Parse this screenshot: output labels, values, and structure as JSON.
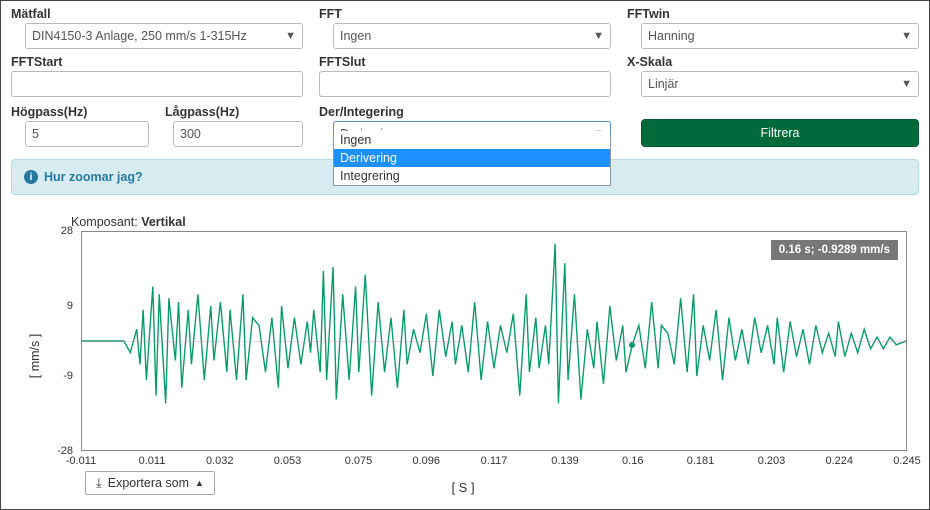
{
  "form": {
    "matfall": {
      "label": "Mätfall",
      "value": "DIN4150-3 Anlage, 250 mm/s 1-315Hz"
    },
    "fft": {
      "label": "FFT",
      "value": "Ingen"
    },
    "fftwin": {
      "label": "FFTwin",
      "value": "Hanning"
    },
    "fftstart": {
      "label": "FFTStart",
      "value": ""
    },
    "fftslut": {
      "label": "FFTSlut",
      "value": ""
    },
    "xskala": {
      "label": "X-Skala",
      "value": "Linjär"
    },
    "hogpass": {
      "label": "Högpass(Hz)",
      "value": "5"
    },
    "lagpass": {
      "label": "Lågpass(Hz)",
      "value": "300"
    },
    "derint": {
      "label": "Der/Integering",
      "value": "Derivering",
      "options": [
        "Ingen",
        "Derivering",
        "Integrering"
      ]
    },
    "filter_btn": "Filtrera"
  },
  "alert": {
    "text": "Hur zoomar jag?"
  },
  "component": {
    "label": "Komposant: ",
    "value": "Vertikal"
  },
  "chart_data": {
    "type": "line",
    "title": "",
    "xlabel": "[ S ]",
    "ylabel": "[  mm/s  ]",
    "xlim": [
      -0.011,
      0.245
    ],
    "ylim": [
      -28,
      28
    ],
    "x_ticks": [
      -0.011,
      0.011,
      0.032,
      0.053,
      0.075,
      0.096,
      0.117,
      0.139,
      0.16,
      0.181,
      0.203,
      0.224,
      0.245
    ],
    "y_ticks": [
      -28,
      -9,
      9,
      28
    ],
    "tooltip": "0.16 s; -0.9289 mm/s",
    "cursor": {
      "x": 0.16,
      "y": -0.9289
    },
    "x": [
      -0.011,
      -0.008,
      -0.006,
      -0.004,
      -0.002,
      0.0,
      0.002,
      0.004,
      0.006,
      0.007,
      0.008,
      0.009,
      0.011,
      0.012,
      0.013,
      0.015,
      0.016,
      0.018,
      0.019,
      0.02,
      0.022,
      0.023,
      0.025,
      0.027,
      0.029,
      0.03,
      0.032,
      0.034,
      0.035,
      0.037,
      0.039,
      0.04,
      0.042,
      0.044,
      0.046,
      0.048,
      0.05,
      0.051,
      0.053,
      0.055,
      0.057,
      0.059,
      0.06,
      0.061,
      0.063,
      0.064,
      0.065,
      0.067,
      0.068,
      0.07,
      0.072,
      0.074,
      0.075,
      0.077,
      0.079,
      0.081,
      0.083,
      0.085,
      0.087,
      0.089,
      0.09,
      0.092,
      0.094,
      0.096,
      0.098,
      0.1,
      0.102,
      0.104,
      0.105,
      0.107,
      0.109,
      0.111,
      0.113,
      0.115,
      0.117,
      0.119,
      0.121,
      0.123,
      0.125,
      0.127,
      0.128,
      0.13,
      0.131,
      0.133,
      0.134,
      0.136,
      0.137,
      0.139,
      0.14,
      0.142,
      0.144,
      0.146,
      0.148,
      0.149,
      0.151,
      0.153,
      0.155,
      0.157,
      0.158,
      0.16,
      0.162,
      0.164,
      0.166,
      0.168,
      0.169,
      0.171,
      0.173,
      0.175,
      0.177,
      0.179,
      0.18,
      0.182,
      0.184,
      0.186,
      0.188,
      0.19,
      0.192,
      0.194,
      0.196,
      0.198,
      0.2,
      0.202,
      0.204,
      0.205,
      0.207,
      0.209,
      0.211,
      0.213,
      0.215,
      0.217,
      0.219,
      0.221,
      0.223,
      0.224,
      0.226,
      0.228,
      0.23,
      0.232,
      0.234,
      0.236,
      0.238,
      0.24,
      0.242,
      0.245
    ],
    "values": [
      0,
      0,
      0,
      0,
      0,
      0,
      0,
      -3,
      3,
      -6,
      8,
      -10,
      14,
      -14,
      12,
      -16,
      11,
      -5,
      10,
      -12,
      8,
      -6,
      12,
      -10,
      9,
      -5,
      10,
      -8,
      8,
      -10,
      12,
      -10,
      6,
      4,
      -8,
      6,
      -12,
      9,
      -7,
      6,
      -6,
      5,
      -3,
      8,
      -8,
      18,
      -10,
      19,
      -15,
      12,
      -10,
      14,
      -8,
      17,
      -14,
      10,
      -8,
      6,
      -12,
      8,
      -6,
      3,
      -3,
      7,
      -9,
      8,
      -4,
      5,
      -6,
      4,
      -8,
      10,
      -10,
      5,
      -7,
      4,
      -3,
      7,
      -14,
      12,
      -8,
      6,
      -7,
      4,
      -6,
      25,
      -16,
      20,
      -10,
      12,
      -15,
      3,
      -7,
      5,
      -11,
      9,
      -5,
      4,
      -8,
      -0.9,
      4,
      -7,
      10,
      -7,
      4,
      2,
      -6,
      11,
      -8,
      12,
      -9,
      4,
      -5,
      8,
      -10,
      6,
      -5,
      3,
      -6,
      6,
      -3,
      4,
      -6,
      6,
      -8,
      5,
      -4,
      3,
      -6,
      4,
      -3,
      2,
      -4,
      5,
      -4,
      2,
      -3,
      3,
      -2,
      1,
      -2,
      1,
      -1,
      0
    ]
  },
  "export": {
    "label": "Exportera som"
  }
}
